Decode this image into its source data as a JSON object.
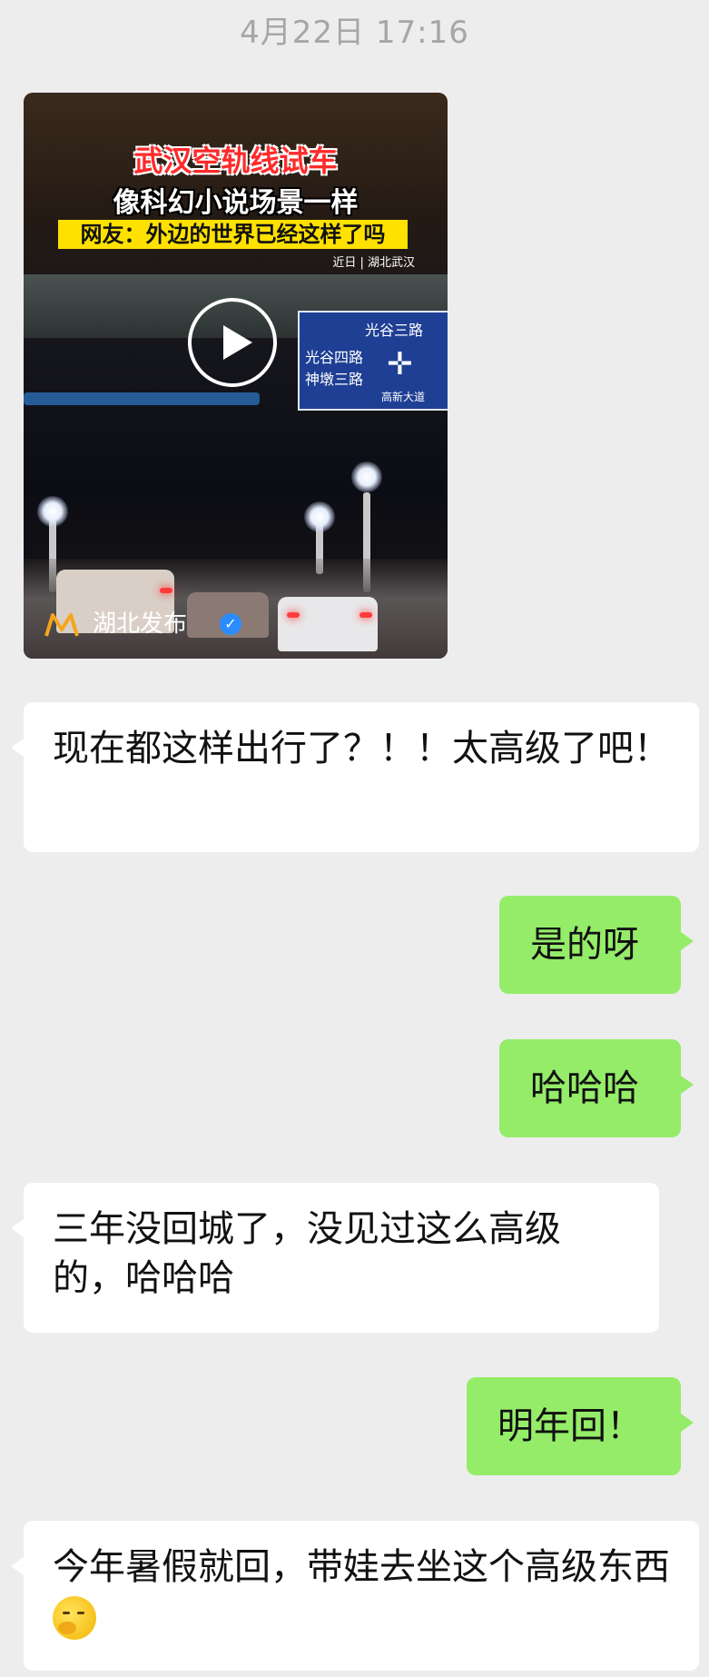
{
  "timestamp": "4月22日 17:16",
  "video": {
    "title_line1": "武汉空轨线试车",
    "title_line2": "像科幻小说场景一样",
    "title_line3": "网友：外边的世界已经这样了吗",
    "meta": "近日  |  湖北武汉",
    "sign": {
      "line1": "光谷三路",
      "line2": "光谷四路",
      "line3": "神墩三路",
      "line4": "高新大道"
    },
    "source": "湖北发布",
    "play_icon": "play-icon",
    "verified_icon": "verified-badge-icon"
  },
  "messages": [
    {
      "side": "left",
      "text": "现在都这样出行了？！！太高级了吧！"
    },
    {
      "side": "right",
      "text": "是的呀"
    },
    {
      "side": "right",
      "text": "哈哈哈"
    },
    {
      "side": "left",
      "text": "三年没回城了，没见过这么高级的，哈哈哈"
    },
    {
      "side": "right",
      "text": "明年回！"
    },
    {
      "side": "left",
      "text": "今年暑假就回，带娃去坐这个高级东西",
      "emoji": "thinking-face-emoji"
    }
  ],
  "colors": {
    "background": "#ededed",
    "incoming_bubble": "#ffffff",
    "outgoing_bubble": "#95ec69",
    "timestamp": "#a6a6a6"
  }
}
